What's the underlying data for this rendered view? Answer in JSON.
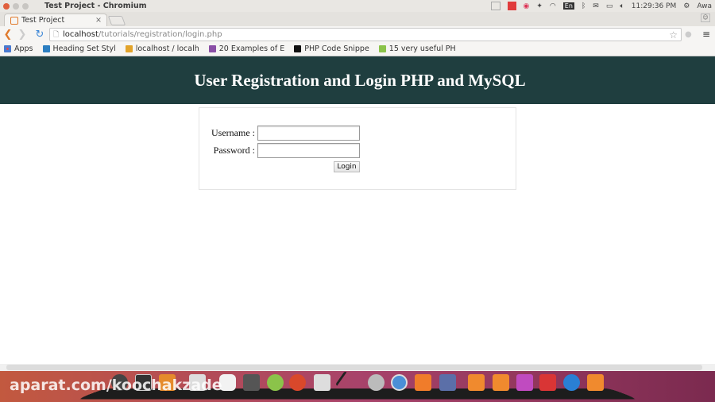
{
  "window": {
    "title": "Test Project - Chromium"
  },
  "tray": {
    "input_lang": "En",
    "clock": "11:29:36 PM",
    "user": "Awa"
  },
  "tab": {
    "title": "Test Project",
    "close": "×"
  },
  "address": {
    "host": "localhost",
    "path": "/tutorials/registration/login.php"
  },
  "bookmarks": [
    {
      "label": "Apps",
      "icon": "apps-grid-icon",
      "color": "#4a7bd0"
    },
    {
      "label": "Heading Set Styl",
      "icon": "bookmark-favicon",
      "color": "#2d7fc1"
    },
    {
      "label": "localhost / localh",
      "icon": "phpmyadmin-icon",
      "color": "#e2a32a"
    },
    {
      "label": "20 Examples of E",
      "icon": "bookmark-favicon",
      "color": "#8a4fa6"
    },
    {
      "label": "PHP Code Snippe",
      "icon": "phpstorm-icon",
      "color": "#111111"
    },
    {
      "label": "15 very useful PH",
      "icon": "vp-icon",
      "color": "#8bc34a"
    }
  ],
  "page": {
    "heading": "User Registration and Login PHP and MySQL",
    "header_color": "#1f3e3f",
    "form": {
      "username_label": "Username :",
      "username_value": "",
      "password_label": "Password :",
      "password_value": "",
      "login_button": "Login"
    }
  },
  "dock": {
    "watermark": "aparat.com/koochakzade"
  }
}
